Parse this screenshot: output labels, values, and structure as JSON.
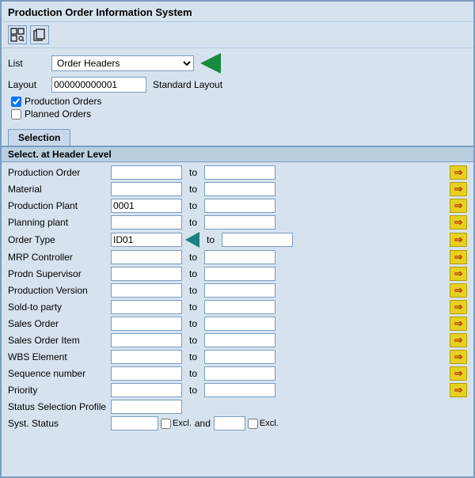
{
  "window": {
    "title": "Production Order Information System"
  },
  "toolbar": {
    "btn1_icon": "⊞",
    "btn2_icon": "⊟"
  },
  "form": {
    "list_label": "List",
    "list_value": "Order Headers",
    "layout_label": "Layout",
    "layout_value": "000000000001",
    "standard_layout": "Standard Layout",
    "checkbox1_label": "Production Orders",
    "checkbox1_checked": true,
    "checkbox2_label": "Planned Orders",
    "checkbox2_checked": false
  },
  "tab": {
    "selection_label": "Selection"
  },
  "section": {
    "header": "Select. at Header Level"
  },
  "fields": [
    {
      "label": "Production Order",
      "value": "",
      "to_value": "",
      "show_arrow": true
    },
    {
      "label": "Material",
      "value": "",
      "to_value": "",
      "show_arrow": true
    },
    {
      "label": "Production Plant",
      "value": "0001",
      "to_value": "",
      "show_arrow": true
    },
    {
      "label": "Planning plant",
      "value": "",
      "to_value": "",
      "show_arrow": true
    },
    {
      "label": "Order Type",
      "value": "ID01",
      "to_value": "",
      "show_arrow": true
    },
    {
      "label": "MRP Controller",
      "value": "",
      "to_value": "",
      "show_arrow": true
    },
    {
      "label": "Prodn Supervisor",
      "value": "",
      "to_value": "",
      "show_arrow": true
    },
    {
      "label": "Production Version",
      "value": "",
      "to_value": "",
      "show_arrow": true
    },
    {
      "label": "Sold-to party",
      "value": "",
      "to_value": "",
      "show_arrow": true
    },
    {
      "label": "Sales Order",
      "value": "",
      "to_value": "",
      "show_arrow": true
    },
    {
      "label": "Sales Order Item",
      "value": "",
      "to_value": "",
      "show_arrow": true
    },
    {
      "label": "WBS Element",
      "value": "",
      "to_value": "",
      "show_arrow": true
    },
    {
      "label": "Sequence number",
      "value": "",
      "to_value": "",
      "show_arrow": true
    },
    {
      "label": "Priority",
      "value": "",
      "to_value": "",
      "show_arrow": true
    },
    {
      "label": "Status Selection Profile",
      "value": "",
      "to_value": null,
      "show_arrow": false
    },
    {
      "label": "Syst. Status",
      "value": "",
      "excl": true,
      "and": true,
      "and_value": "",
      "and_excl": true,
      "show_arrow": false
    }
  ],
  "colors": {
    "arrow_yellow": "#e8d020",
    "arrow_green": "#2a8a2a",
    "teal_arrow": "#1a8080",
    "header_bg": "#b8cfe0",
    "border": "#7a9cbf"
  }
}
